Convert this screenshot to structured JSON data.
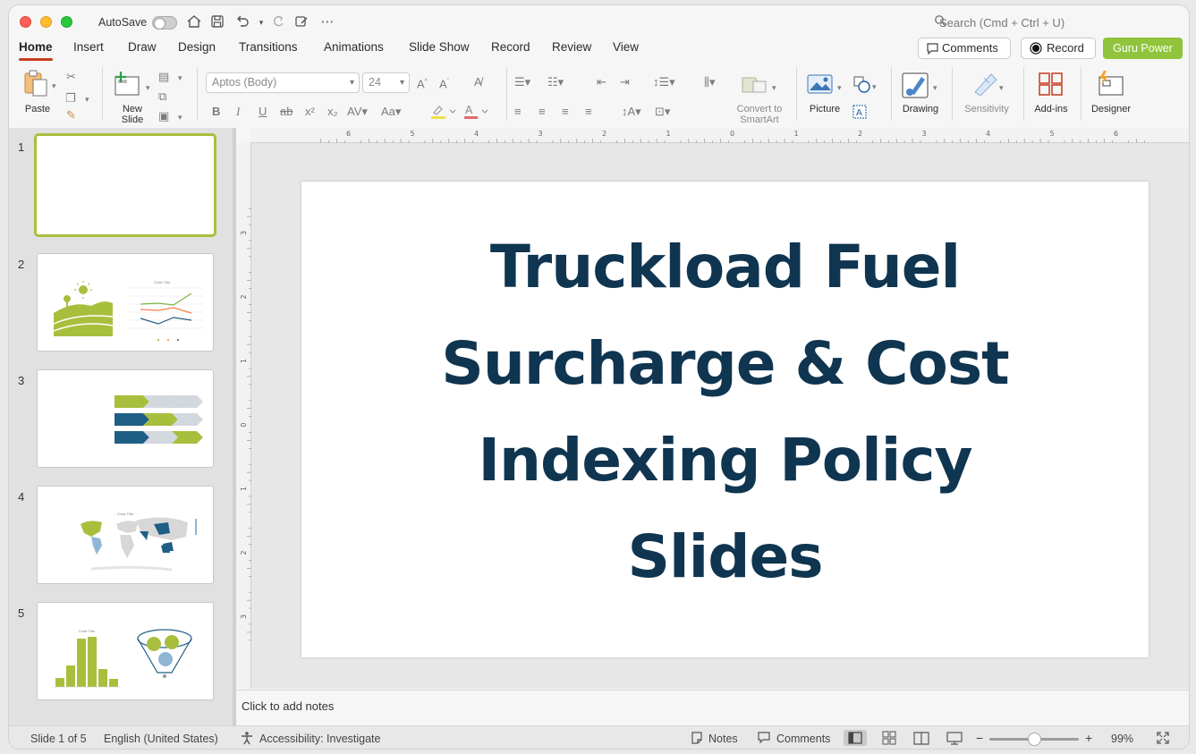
{
  "titlebar": {
    "autosave_label": "AutoSave",
    "search_placeholder": "Search (Cmd + Ctrl + U)"
  },
  "tabs": [
    {
      "label": "Home",
      "active": true
    },
    {
      "label": "Insert"
    },
    {
      "label": "Draw"
    },
    {
      "label": "Design"
    },
    {
      "label": "Transitions"
    },
    {
      "label": "Animations"
    },
    {
      "label": "Slide Show"
    },
    {
      "label": "Record"
    },
    {
      "label": "Review"
    },
    {
      "label": "View"
    }
  ],
  "header_buttons": {
    "comments": "Comments",
    "record": "Record",
    "guru": "Guru Power"
  },
  "ribbon": {
    "paste": "Paste",
    "new_slide_line1": "New",
    "new_slide_line2": "Slide",
    "font_name": "Aptos (Body)",
    "font_size": "24",
    "convert_line1": "Convert to",
    "convert_line2": "SmartArt",
    "picture": "Picture",
    "drawing": "Drawing",
    "sensitivity": "Sensitivity",
    "addins": "Add-ins",
    "designer": "Designer"
  },
  "thumbnails": [
    {
      "number": "1",
      "selected": true
    },
    {
      "number": "2"
    },
    {
      "number": "3"
    },
    {
      "number": "4"
    },
    {
      "number": "5"
    }
  ],
  "ruler_top_labels": [
    "6",
    "5",
    "4",
    "3",
    "2",
    "1",
    "0",
    "1",
    "2",
    "3",
    "4",
    "5",
    "6"
  ],
  "ruler_left_labels": [
    "3",
    "2",
    "1",
    "0",
    "1",
    "2",
    "3"
  ],
  "slide": {
    "title_lines": [
      "Truckload Fuel",
      "Surcharge & Cost",
      "Indexing Policy",
      "Slides"
    ]
  },
  "notes_placeholder": "Click to add notes",
  "statusbar": {
    "slide_info": "Slide 1 of 5",
    "language": "English (United States)",
    "accessibility": "Accessibility: Investigate",
    "notes": "Notes",
    "comments": "Comments",
    "zoom": "99%"
  },
  "colors": {
    "accent_tab": "#c43e1c",
    "guru_green": "#8fc43c",
    "title_navy": "#0f3550",
    "thumb_green": "#a8bf3e"
  }
}
